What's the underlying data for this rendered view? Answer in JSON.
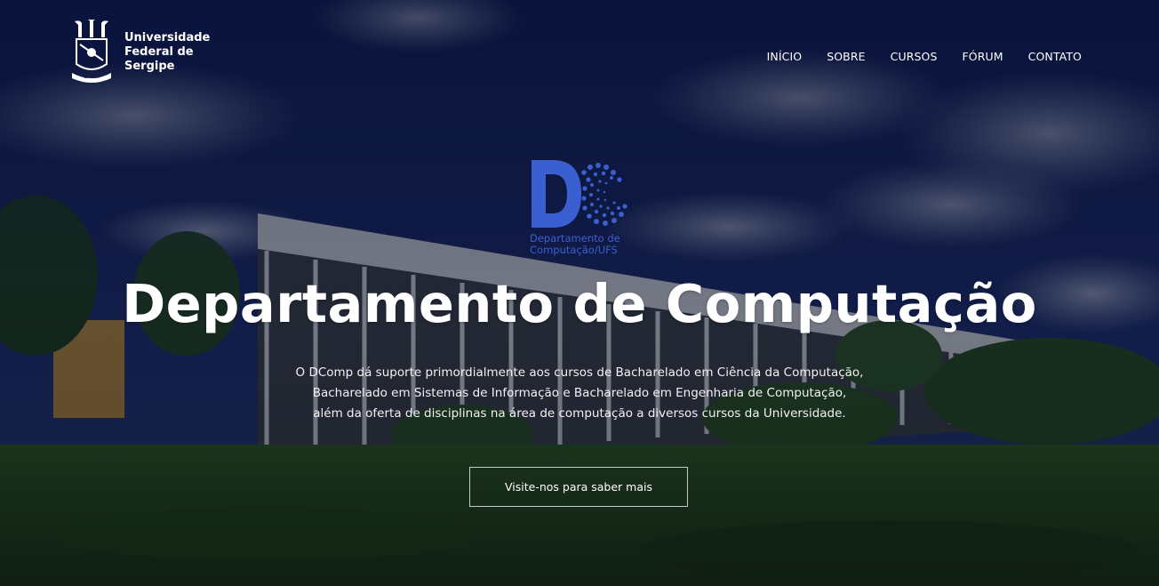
{
  "brand": {
    "line1": "Universidade",
    "line2": "Federal de",
    "line3": "Sergipe"
  },
  "nav": {
    "items": [
      {
        "label": "INÍCIO"
      },
      {
        "label": "SOBRE"
      },
      {
        "label": "CURSOS"
      },
      {
        "label": "FÓRUM"
      },
      {
        "label": "CONTATO"
      }
    ]
  },
  "logo": {
    "caption_line1": "Departamento de",
    "caption_line2": "Computação/UFS",
    "color": "#3a5fd0"
  },
  "hero": {
    "title": "Departamento de Computação",
    "description_line1": "O DComp dá suporte primordialmente aos cursos de Bacharelado em Ciência da Computação,",
    "description_line2": "Bacharelado em Sistemas de Informação e Bacharelado em Engenharia de Computação,",
    "description_line3": "além da oferta de disciplinas na área de computação a diversos cursos da Universidade.",
    "cta_label": "Visite-nos para saber mais"
  }
}
